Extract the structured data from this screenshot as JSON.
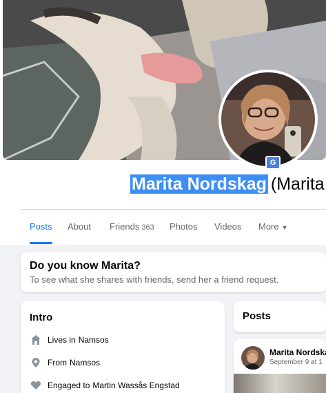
{
  "profile": {
    "name": "Marita Nordskag",
    "alt_name": "(Marita",
    "translate_badge": "G"
  },
  "tabs": [
    {
      "label": "Posts",
      "active": true
    },
    {
      "label": "About"
    },
    {
      "label": "Friends",
      "count": "363"
    },
    {
      "label": "Photos"
    },
    {
      "label": "Videos"
    },
    {
      "label": "More"
    }
  ],
  "know_card": {
    "title": "Do you know Marita?",
    "subtitle": "To see what she shares with friends, send her a friend request."
  },
  "intro": {
    "title": "Intro",
    "items": [
      {
        "icon": "house-icon",
        "prefix": "Lives in",
        "value": "Namsos"
      },
      {
        "icon": "location-pin-icon",
        "prefix": "From",
        "value": "Namsos"
      },
      {
        "icon": "heart-icon",
        "prefix": "Engaged to",
        "value": "Martin Wassås Engstad"
      }
    ]
  },
  "posts": {
    "title": "Posts",
    "author": "Marita Nordska",
    "date": "September 9 at 1"
  },
  "colors": {
    "accent": "#1877f2",
    "selection": "#3d8ef5",
    "background": "#f0f2f5"
  }
}
